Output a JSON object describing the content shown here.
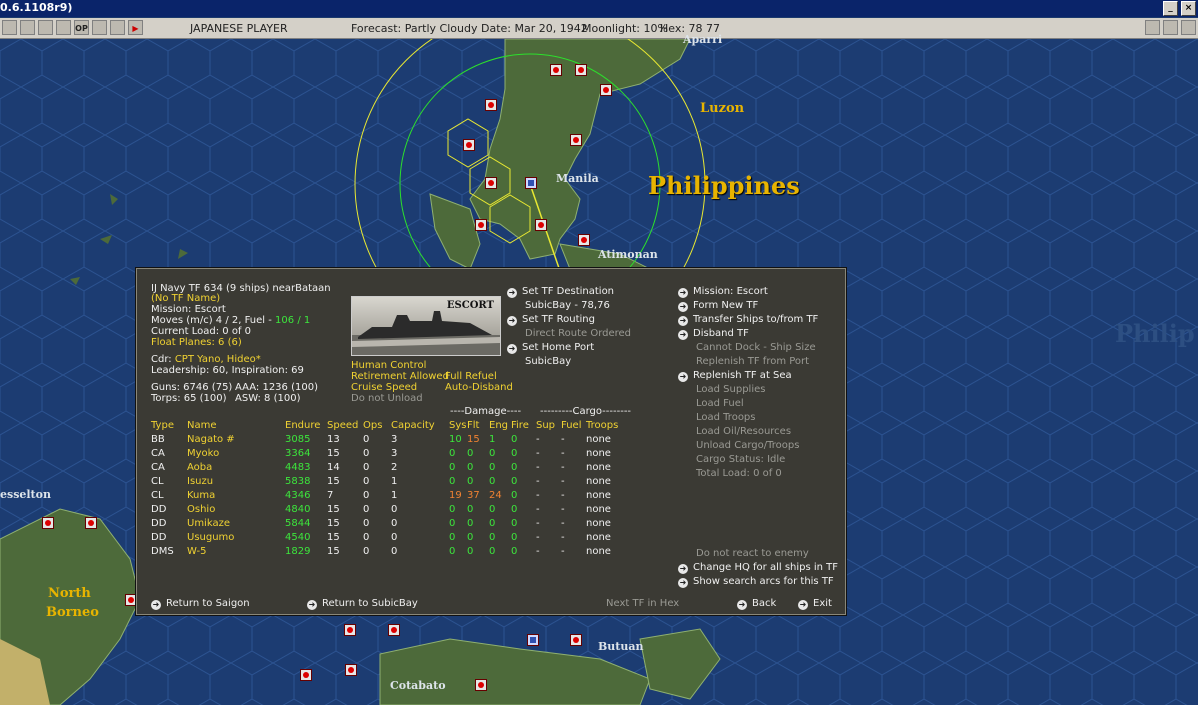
{
  "app": {
    "title": "0.6.1108r9)"
  },
  "toolbar": {
    "buttons": [
      "OP"
    ],
    "player": "JAPANESE PLAYER",
    "forecast": "Forecast: Partly Cloudy",
    "date": "Date: Mar 20, 1942",
    "moonlight": "Moonlight: 10%",
    "hex": "Hex: 78 77"
  },
  "map": {
    "labels": {
      "philippines": "Philippines",
      "philippines_right": "Philip",
      "luzon": "Luzon",
      "manila": "Manila",
      "aparri": "Aparri",
      "atimonan": "Atimonan",
      "jesselton": "esselton",
      "north_borneo_1": "North",
      "north_borneo_2": "Borneo",
      "butuan": "Butuan",
      "cotabato": "Cotabato"
    }
  },
  "panel": {
    "header": {
      "tf": "IJ Navy TF 634 (9 ships)  near",
      "location": "Bataan",
      "tf_name": "(No TF Name)",
      "mission": "Mission: Escort",
      "moves": "Moves (m/c) 4 / 2, Fuel - ",
      "fuel": "106 / 1",
      "current_load": "Current Load: 0 of 0",
      "float_planes": "Float Planes: 6 (6)",
      "cdr_label": "Cdr: ",
      "cdr_name": "CPT Yano, Hideo*",
      "leadership": "Leadership: 60, Inspiration: 69",
      "guns": "Guns: 6746 (75)",
      "aaa": "AAA: 1236 (100)",
      "torps": "Torps: 65 (100)",
      "asw": "ASW: 8 (100)"
    },
    "ship_image_label": "ESCORT",
    "options": {
      "human_control": "Human Control",
      "retirement": "Retirement Allowed",
      "full_refuel": "Full Refuel",
      "cruise_speed": "Cruise Speed",
      "auto_disband": "Auto-Disband",
      "do_not_unload": "Do not Unload"
    },
    "middle_commands": {
      "set_destination": "Set TF Destination",
      "destination_value": "SubicBay - 78,76",
      "set_routing": "Set TF Routing",
      "routing_value": "Direct Route Ordered",
      "set_home_port": "Set Home Port",
      "home_port_value": "SubicBay"
    },
    "right_commands": {
      "mission": "Mission: Escort",
      "form_new": "Form New TF",
      "transfer": "Transfer Ships to/from TF",
      "disband": "Disband TF",
      "cannot_dock": "Cannot Dock - Ship Size",
      "replenish_port": "Replenish TF from Port",
      "replenish_sea": "Replenish TF at Sea",
      "load_supplies": "Load Supplies",
      "load_fuel": "Load Fuel",
      "load_troops": "Load Troops",
      "load_oil": "Load Oil/Resources",
      "unload_cargo": "Unload Cargo/Troops",
      "cargo_status": "Cargo Status: Idle",
      "total_load": "Total Load: 0 of 0",
      "no_react": "Do not react to enemy",
      "change_hq": "Change HQ for all ships in TF",
      "show_arcs": "Show search arcs for this TF"
    },
    "table": {
      "group_damage": "----Damage----",
      "group_cargo": "---------Cargo--------",
      "columns": [
        "Type",
        "Name",
        "Endure",
        "Speed",
        "Ops",
        "Capacity",
        "Sys",
        "Flt",
        "Eng",
        "Fire",
        "Sup",
        "Fuel",
        "Troops"
      ],
      "rows": [
        {
          "type": "BB",
          "name": "Nagato #",
          "endure": "3085",
          "speed": "13",
          "ops": "0",
          "capacity": "3",
          "sys": "10",
          "flt": "15",
          "eng": "1",
          "fire": "0",
          "sup": "-",
          "fuel": "-",
          "troops": "none"
        },
        {
          "type": "CA",
          "name": "Myoko",
          "endure": "3364",
          "speed": "15",
          "ops": "0",
          "capacity": "3",
          "sys": "0",
          "flt": "0",
          "eng": "0",
          "fire": "0",
          "sup": "-",
          "fuel": "-",
          "troops": "none"
        },
        {
          "type": "CA",
          "name": "Aoba",
          "endure": "4483",
          "speed": "14",
          "ops": "0",
          "capacity": "2",
          "sys": "0",
          "flt": "0",
          "eng": "0",
          "fire": "0",
          "sup": "-",
          "fuel": "-",
          "troops": "none"
        },
        {
          "type": "CL",
          "name": "Isuzu",
          "endure": "5838",
          "speed": "15",
          "ops": "0",
          "capacity": "1",
          "sys": "0",
          "flt": "0",
          "eng": "0",
          "fire": "0",
          "sup": "-",
          "fuel": "-",
          "troops": "none"
        },
        {
          "type": "CL",
          "name": "Kuma",
          "endure": "4346",
          "speed": "7",
          "ops": "0",
          "capacity": "1",
          "sys": "19",
          "flt": "37",
          "eng": "24",
          "fire": "0",
          "sup": "-",
          "fuel": "-",
          "troops": "none"
        },
        {
          "type": "DD",
          "name": "Oshio",
          "endure": "4840",
          "speed": "15",
          "ops": "0",
          "capacity": "0",
          "sys": "0",
          "flt": "0",
          "eng": "0",
          "fire": "0",
          "sup": "-",
          "fuel": "-",
          "troops": "none"
        },
        {
          "type": "DD",
          "name": "Umikaze",
          "endure": "5844",
          "speed": "15",
          "ops": "0",
          "capacity": "0",
          "sys": "0",
          "flt": "0",
          "eng": "0",
          "fire": "0",
          "sup": "-",
          "fuel": "-",
          "troops": "none"
        },
        {
          "type": "DD",
          "name": "Usugumo",
          "endure": "4540",
          "speed": "15",
          "ops": "0",
          "capacity": "0",
          "sys": "0",
          "flt": "0",
          "eng": "0",
          "fire": "0",
          "sup": "-",
          "fuel": "-",
          "troops": "none"
        },
        {
          "type": "DMS",
          "name": "W-5",
          "endure": "1829",
          "speed": "15",
          "ops": "0",
          "capacity": "0",
          "sys": "0",
          "flt": "0",
          "eng": "0",
          "fire": "0",
          "sup": "-",
          "fuel": "-",
          "troops": "none"
        }
      ]
    },
    "footer": {
      "return_saigon": "Return to Saigon",
      "return_subic": "Return to SubicBay",
      "next_tf": "Next TF in Hex",
      "back": "Back",
      "exit": "Exit"
    }
  }
}
